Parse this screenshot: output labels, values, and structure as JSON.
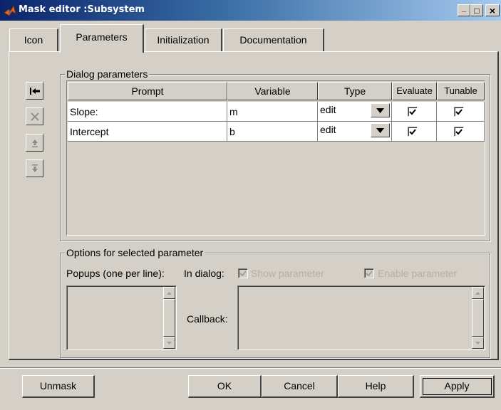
{
  "window": {
    "title": "Mask editor :Subsystem",
    "minimize": "_",
    "maximize": "□",
    "close": "×"
  },
  "tabs": [
    {
      "label": "Icon",
      "active": false
    },
    {
      "label": "Parameters",
      "active": true
    },
    {
      "label": "Initialization",
      "active": false
    },
    {
      "label": "Documentation",
      "active": false
    }
  ],
  "dialog_parameters": {
    "group_label": "Dialog parameters",
    "side_buttons": [
      "add-parameter-icon",
      "delete-icon",
      "move-up-icon",
      "move-down-icon"
    ],
    "columns": [
      "Prompt",
      "Variable",
      "Type",
      "Evaluate",
      "Tunable"
    ],
    "rows": [
      {
        "prompt": "Slope:",
        "variable": "m",
        "type": "edit",
        "evaluate": true,
        "tunable": true
      },
      {
        "prompt": "Intercept",
        "variable": "b",
        "type": "edit",
        "evaluate": true,
        "tunable": true
      }
    ]
  },
  "options": {
    "group_label": "Options for selected parameter",
    "popups_label": "Popups (one per line):",
    "in_dialog_label": "In dialog:",
    "show_parameter": {
      "label": "Show parameter",
      "checked": true,
      "enabled": false
    },
    "enable_parameter": {
      "label": "Enable parameter",
      "checked": true,
      "enabled": false
    },
    "callback_label": "Callback:"
  },
  "buttons": {
    "unmask": "Unmask",
    "ok": "OK",
    "cancel": "Cancel",
    "help": "Help",
    "apply": "Apply"
  },
  "colors": {
    "face": "#d4d0c8",
    "title_start": "#0a246a",
    "title_end": "#a6caf0",
    "disabled_text": "#b4b0a8"
  }
}
